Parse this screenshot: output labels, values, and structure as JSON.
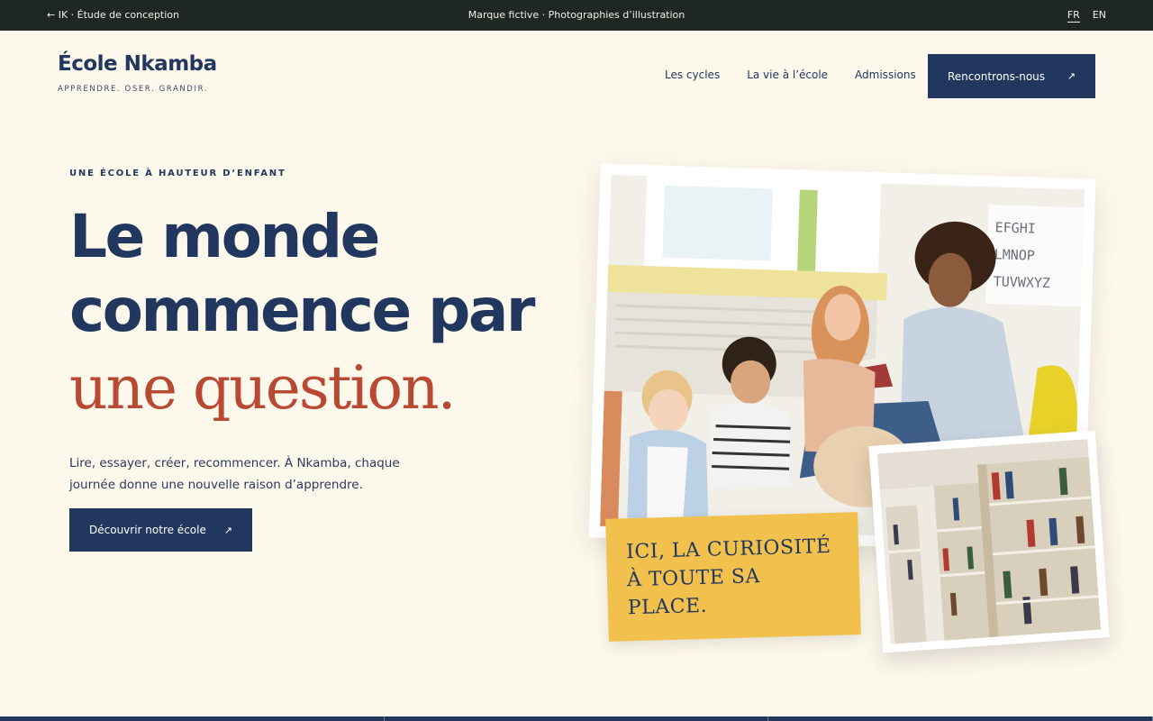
{
  "topbar": {
    "back_label": "← IK · Étude de conception",
    "center_label": "Marque fictive · Photographies d’illustration",
    "languages": [
      {
        "label": "FR",
        "active": true
      },
      {
        "label": "EN",
        "active": false
      }
    ]
  },
  "brand": {
    "name": "École Nkamba",
    "tagline": "APPRENDRE. OSER. GRANDIR."
  },
  "nav": {
    "items": [
      {
        "label": "Les cycles"
      },
      {
        "label": "La vie à l’école"
      },
      {
        "label": "Admissions"
      }
    ],
    "cta_label": "Rencontrons-nous",
    "cta_icon": "↗"
  },
  "hero": {
    "eyebrow": "UNE ÉCOLE À HAUTEUR D’ENFANT",
    "title_line1": "Le monde",
    "title_line2": "commence par",
    "title_accent": "une question.",
    "lead": "Lire, essayer, créer, recommencer. À Nkamba, chaque journée donne une nouvelle raison d’apprendre.",
    "cta_label": "Découvrir notre école",
    "cta_icon": "↗",
    "quote": "ICI, LA CURIOSITÉ À TOUTE SA PLACE."
  },
  "colors": {
    "navy": "#22375e",
    "accent": "#b84a34",
    "yellow": "#f2c04c",
    "cream": "#fdf8ec",
    "topbar": "#1f2724"
  }
}
